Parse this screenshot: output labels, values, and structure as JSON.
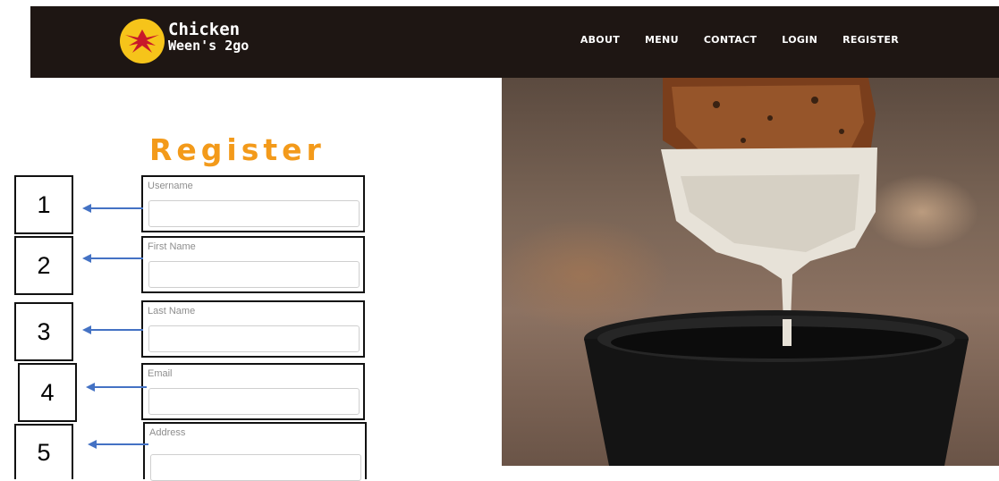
{
  "brand": {
    "line1": "Chicken",
    "line2": "Ween's 2go",
    "logo_icon": "wing-icon",
    "badge_color": "#f6c41a"
  },
  "nav": {
    "items": [
      {
        "label": "ABOUT"
      },
      {
        "label": "MENU"
      },
      {
        "label": "CONTACT"
      },
      {
        "label": "LOGIN"
      },
      {
        "label": "REGISTER"
      }
    ]
  },
  "register": {
    "title": "Register",
    "fields": [
      {
        "label": "Username",
        "value": "",
        "annotation": "1"
      },
      {
        "label": "First Name",
        "value": "",
        "annotation": "2"
      },
      {
        "label": "Last Name",
        "value": "",
        "annotation": "3"
      },
      {
        "label": "Email",
        "value": "",
        "annotation": "4"
      },
      {
        "label": "Address",
        "value": "",
        "annotation": "5"
      }
    ]
  },
  "colors": {
    "header_bg": "#1e1613",
    "title_orange": "#f39a1a",
    "arrow_blue": "#4472c4"
  }
}
